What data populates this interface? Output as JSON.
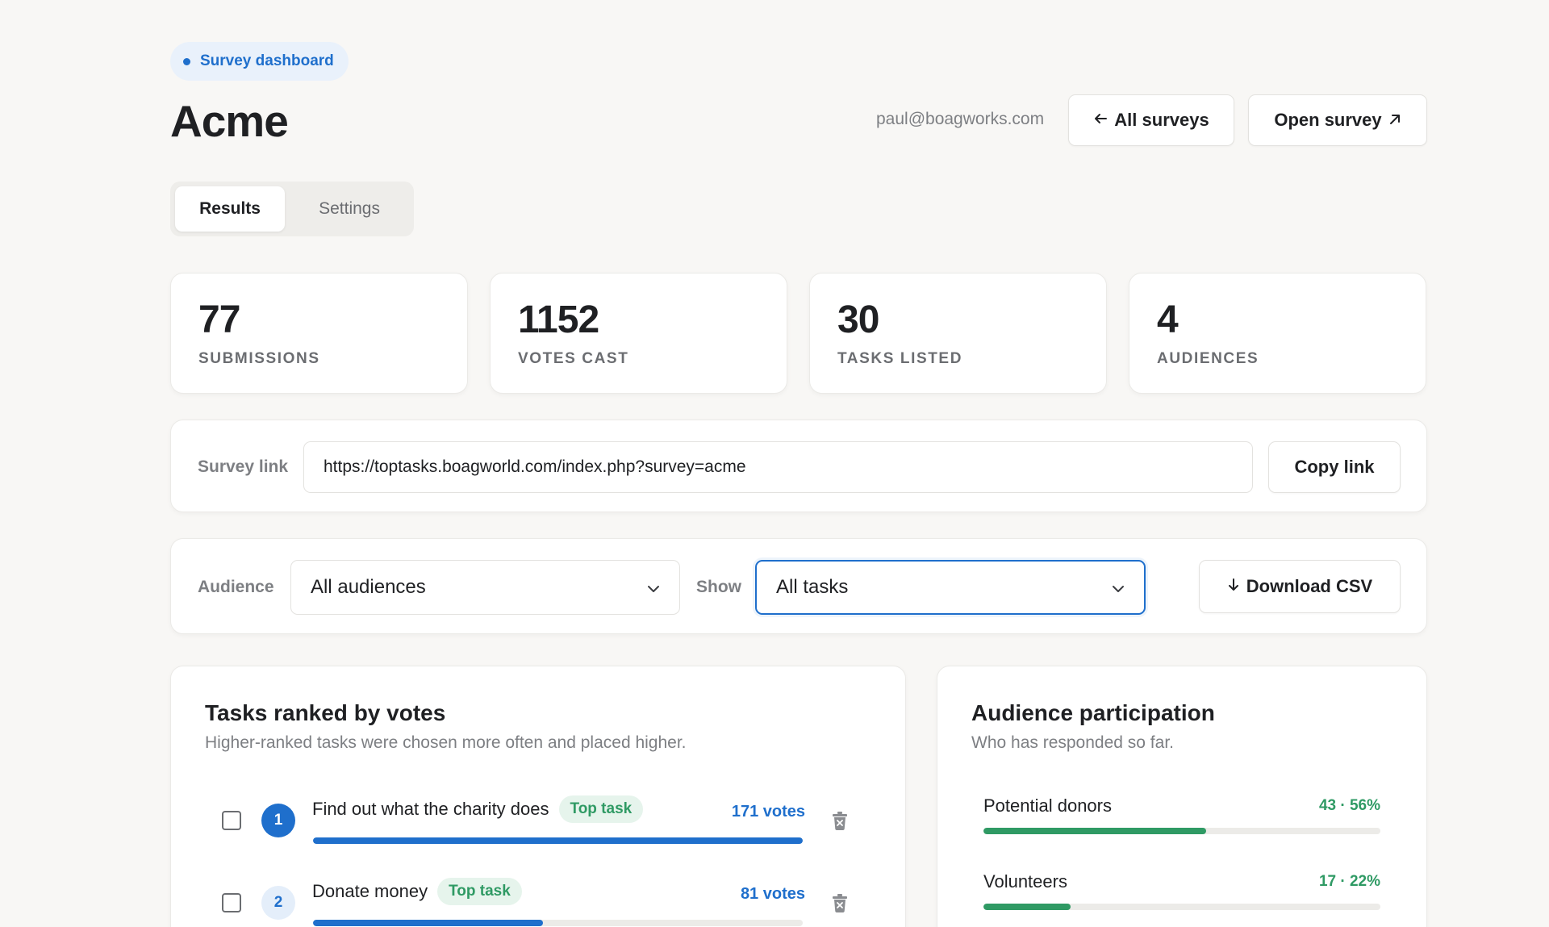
{
  "header": {
    "badge": "Survey dashboard",
    "title": "Acme",
    "email": "paul@boagworks.com",
    "all_surveys_label": "All surveys",
    "open_survey_label": "Open survey"
  },
  "tabs": [
    {
      "label": "Results",
      "active": true
    },
    {
      "label": "Settings",
      "active": false
    }
  ],
  "stats": [
    {
      "value": "77",
      "label": "SUBMISSIONS"
    },
    {
      "value": "1152",
      "label": "VOTES CAST"
    },
    {
      "value": "30",
      "label": "TASKS LISTED"
    },
    {
      "value": "4",
      "label": "AUDIENCES"
    }
  ],
  "survey_link": {
    "label": "Survey link",
    "value": "https://toptasks.boagworld.com/index.php?survey=acme",
    "copy_label": "Copy link"
  },
  "filters": {
    "audience_label": "Audience",
    "audience_value": "All audiences",
    "show_label": "Show",
    "show_value": "All tasks",
    "download_label": "Download CSV"
  },
  "tasks_panel": {
    "title": "Tasks ranked by votes",
    "subtitle": "Higher-ranked tasks were chosen more often and placed higher.",
    "tasks": [
      {
        "rank": "1",
        "name": "Find out what the charity does",
        "badge": "Top task",
        "votes": "171 votes",
        "share": 1.0
      },
      {
        "rank": "2",
        "name": "Donate money",
        "badge": "Top task",
        "votes": "81 votes",
        "share": 0.47
      }
    ]
  },
  "audience_panel": {
    "title": "Audience participation",
    "subtitle": "Who has responded so far.",
    "audiences": [
      {
        "name": "Potential donors",
        "value": "43 · 56%",
        "percent": 56
      },
      {
        "name": "Volunteers",
        "value": "17 · 22%",
        "percent": 22
      }
    ]
  },
  "colors": {
    "accent": "#1f6fcc",
    "success": "#2f9a64",
    "background": "#f8f7f5"
  }
}
